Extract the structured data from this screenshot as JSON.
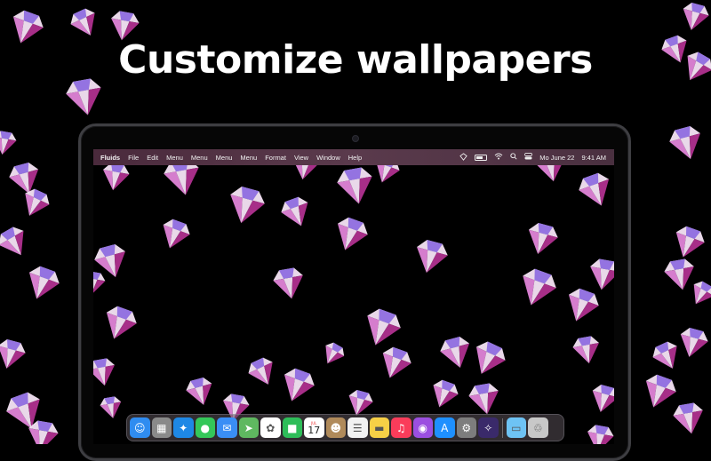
{
  "headline": "Customize wallpapers",
  "menubar": {
    "app_name": "Fluids",
    "menus": [
      "File",
      "Edit",
      "Menu",
      "Menu",
      "Menu",
      "Menu",
      "Format",
      "View",
      "Window",
      "Help"
    ],
    "date": "Mo June 22",
    "time": "9:41 AM"
  },
  "dock": {
    "calendar_day": "17",
    "calendar_month": "JUL",
    "apps": [
      {
        "name": "finder-icon",
        "color": "#2f8cf0",
        "glyph": "☺"
      },
      {
        "name": "launchpad-icon",
        "color": "#8a8a8a",
        "glyph": "▦"
      },
      {
        "name": "safari-icon",
        "color": "#1e88e5",
        "glyph": "✦"
      },
      {
        "name": "messages-icon",
        "color": "#34c759",
        "glyph": "●"
      },
      {
        "name": "mail-icon",
        "color": "#3a8ef5",
        "glyph": "✉"
      },
      {
        "name": "maps-icon",
        "color": "#5fb860",
        "glyph": "➤"
      },
      {
        "name": "photos-icon",
        "color": "#ffffff",
        "glyph": "✿"
      },
      {
        "name": "facetime-icon",
        "color": "#2ebd59",
        "glyph": "■"
      },
      {
        "name": "calendar-icon",
        "color": "#ffffff",
        "glyph": ""
      },
      {
        "name": "contacts-icon",
        "color": "#b08a5a",
        "glyph": "☻"
      },
      {
        "name": "reminders-icon",
        "color": "#f2f2f2",
        "glyph": "☰"
      },
      {
        "name": "notes-icon",
        "color": "#f7d046",
        "glyph": "▬"
      },
      {
        "name": "music-icon",
        "color": "#fa3c5a",
        "glyph": "♫"
      },
      {
        "name": "podcasts-icon",
        "color": "#9b4fe0",
        "glyph": "◉"
      },
      {
        "name": "app-store-icon",
        "color": "#1e90ff",
        "glyph": "A"
      },
      {
        "name": "system-preferences-icon",
        "color": "#7d7d7d",
        "glyph": "⚙"
      },
      {
        "name": "fluids-app-icon",
        "color": "#3a2a6a",
        "glyph": "✧"
      },
      {
        "name": "downloads-folder-icon",
        "color": "#6ec3f4",
        "glyph": "▭"
      },
      {
        "name": "trash-icon",
        "color": "#c8c8c8",
        "glyph": "♲"
      }
    ]
  },
  "colors": {
    "gem_light": "#f6e4f6",
    "gem_mid": "#e084d8",
    "gem_deep": "#b0308f",
    "gem_violet": "#8f6ee0",
    "background": "#000000"
  }
}
